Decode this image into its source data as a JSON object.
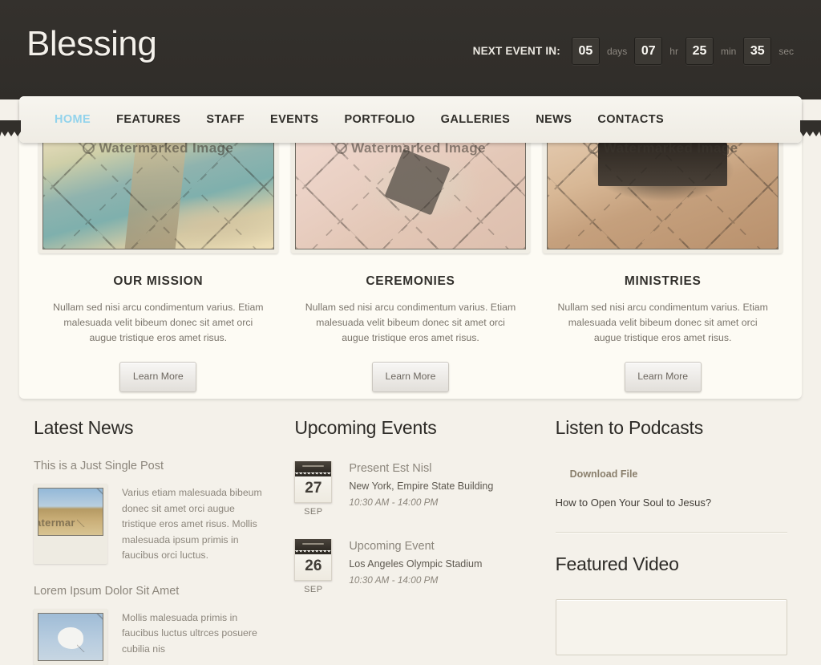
{
  "header": {
    "logo": "Blessing",
    "countdown": {
      "label": "NEXT EVENT IN:",
      "units": [
        {
          "value": "05",
          "unit": "days"
        },
        {
          "value": "07",
          "unit": "hr"
        },
        {
          "value": "25",
          "unit": "min"
        },
        {
          "value": "35",
          "unit": "sec"
        }
      ]
    }
  },
  "nav": {
    "items": [
      {
        "label": "HOME",
        "active": true
      },
      {
        "label": "FEATURES",
        "active": false
      },
      {
        "label": "STAFF",
        "active": false
      },
      {
        "label": "EVENTS",
        "active": false
      },
      {
        "label": "PORTFOLIO",
        "active": false
      },
      {
        "label": "GALLERIES",
        "active": false
      },
      {
        "label": "NEWS",
        "active": false
      },
      {
        "label": "CONTACTS",
        "active": false
      }
    ],
    "active_color": "#92d3ec"
  },
  "features": [
    {
      "title": "OUR MISSION",
      "text": "Nullam sed nisi arcu condimentum varius. Etiam malesuada velit bibeum donec sit amet orci augue tristique eros amet risus.",
      "button": "Learn More",
      "watermark": "Watermarked Image"
    },
    {
      "title": "CEREMONIES",
      "text": "Nullam sed nisi arcu condimentum varius. Etiam malesuada velit bibeum donec sit amet orci augue tristique eros amet risus.",
      "button": "Learn More",
      "watermark": "Watermarked Image"
    },
    {
      "title": "MINISTRIES",
      "text": "Nullam sed nisi arcu condimentum varius. Etiam malesuada velit bibeum donec sit amet orci augue tristique eros amet risus.",
      "button": "Learn More",
      "watermark": "Watermarked Image"
    }
  ],
  "news": {
    "heading": "Latest News",
    "items": [
      {
        "title": "This is a Just Single Post",
        "excerpt": "Varius etiam malesuada bibeum donec sit amet orci augue tristique eros amet risus. Mollis malesuada ipsum primis in faucibus orci luctus.",
        "watermark": "atermar"
      },
      {
        "title": "Lorem Ipsum Dolor Sit Amet",
        "excerpt": "Mollis malesuada primis in faucibus luctus ultrces posuere cubilia nis",
        "watermark": ""
      }
    ]
  },
  "events": {
    "heading": "Upcoming Events",
    "items": [
      {
        "day": "27",
        "month": "SEP",
        "title": "Present Est Nisl",
        "place": "New York, Empire State Building",
        "time": "10:30 AM - 14:00 PM"
      },
      {
        "day": "26",
        "month": "SEP",
        "title": "Upcoming Event",
        "place": "Los Angeles Olympic Stadium",
        "time": "10:30 AM - 14:00 PM"
      }
    ]
  },
  "podcasts": {
    "heading": "Listen to Podcasts",
    "download_label": "Download File",
    "episode_title": "How to Open Your Soul to Jesus?",
    "video_heading": "Featured Video"
  },
  "theme": {
    "header_bg": "#322f2b",
    "page_bg": "#f4f1ea",
    "panel_bg": "#fdfbf4",
    "accent": "#92d3ec",
    "muted_text": "#8c867c"
  }
}
